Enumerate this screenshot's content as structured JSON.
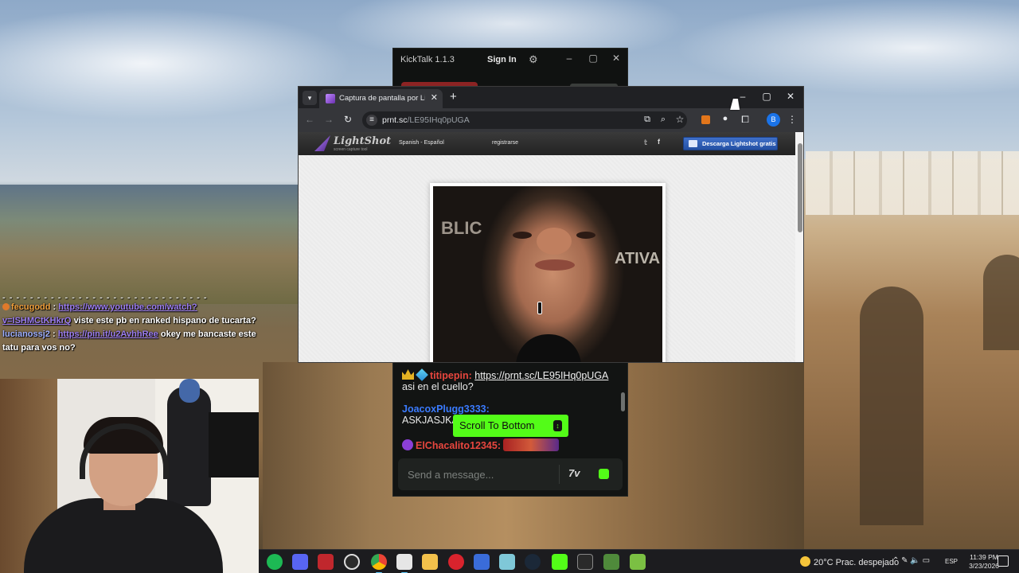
{
  "overlay_chat": {
    "separator": "- - - - - - - - - - - - - - - - - - - - - - - - - - - - - -",
    "messages": [
      {
        "user": "fecugodd",
        "sep": " : ",
        "link": "https://www.youtube.com/watch?",
        "text": ""
      },
      {
        "user": "v=ISHMCtKHkrQ",
        "sep": " ",
        "link": "",
        "text": "viste este pb en ranked hispano de tucarta?"
      },
      {
        "user": "lucianossj2",
        "sep": " : ",
        "link": "https://pin.it/u2AvhhRee",
        "text": " okey me bancaste este tatu para vos no?"
      }
    ]
  },
  "kicktalk": {
    "app_title": "KickTalk 1.1.3",
    "sign_in": "Sign In",
    "icons": {
      "settings": "gear-icon",
      "minimize": "minimize-icon",
      "maximize": "maximize-icon",
      "close": "close-icon"
    },
    "messages": [
      {
        "user": "titipepin:",
        "user_color": "#e8463e",
        "link": "https://prnt.sc/LE95IHq0pUGA",
        "text": "asi en el cuello?"
      },
      {
        "user": "JoacoxPlugg3333:",
        "user_color": "#3a7bff",
        "text": "ASKJASJKA"
      },
      {
        "user": "ElChacalito12345:",
        "user_color": "#e8463e",
        "text": ""
      }
    ],
    "scroll_to_bottom": "Scroll To Bottom",
    "input_placeholder": "Send a message...",
    "seventv_label": "7v",
    "accent": "#53fc18"
  },
  "chrome": {
    "tab_title": "Captura de pantalla por Lightshot",
    "url_host": "prnt.sc",
    "url_path": "/LE95IHq0pUGA",
    "profile_initial": "B",
    "icons": {
      "back": "back-arrow-icon",
      "forward": "forward-arrow-icon",
      "reload": "reload-icon",
      "site_info": "tune-icon",
      "install": "install-app-icon",
      "zoom": "zoom-icon",
      "bookmark": "star-icon",
      "extensions": "puzzle-icon",
      "menu": "kebab-menu-icon"
    }
  },
  "lightshot": {
    "brand": "LightShot",
    "tagline": "screen capture tool",
    "language": "Spanish - Español",
    "register": "registrarse",
    "download_button": "Descarga Lightshot gratis",
    "screenshot_text_left": "BLIC",
    "screenshot_text_right": "ATIVA"
  },
  "taskbar": {
    "apps": [
      "spotify",
      "discord",
      "voicemeeter",
      "obs",
      "chrome",
      "kicktalk",
      "file-explorer",
      "opera",
      "app-blue",
      "app-teal",
      "steam",
      "kick",
      "epic-games",
      "minecraft-launcher",
      "minecraft"
    ],
    "weather_temp": "20°C",
    "weather_desc": "Prac. despejado",
    "language": "ESP",
    "time": "11:39 PM",
    "date": "3/23/2026"
  }
}
